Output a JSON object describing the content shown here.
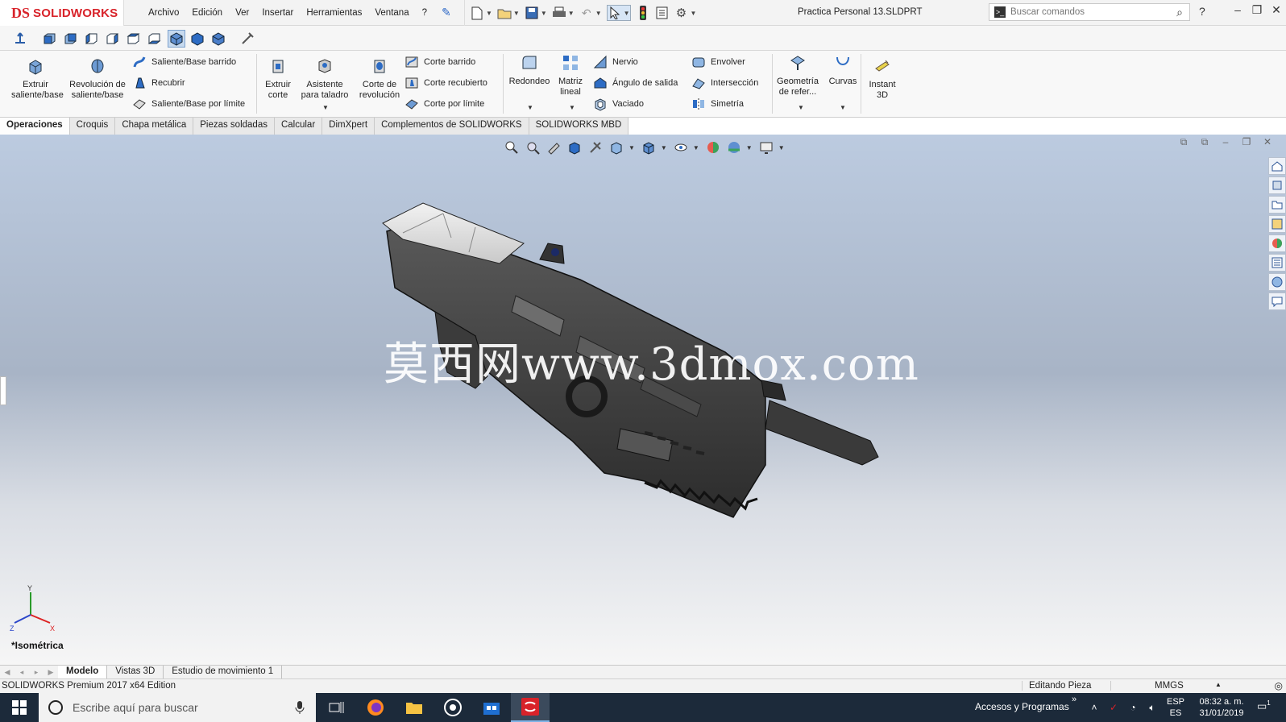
{
  "app": {
    "brand": "SOLIDWORKS",
    "logo_mark": "DS",
    "document_title": "Practica Personal 13.SLDPRT"
  },
  "menu": [
    "Archivo",
    "Edición",
    "Ver",
    "Insertar",
    "Herramientas",
    "Ventana",
    "?"
  ],
  "search": {
    "placeholder": "Buscar comandos"
  },
  "window_controls": {
    "help": "?",
    "minimize": "–",
    "restore": "❐",
    "close": "✕"
  },
  "ribbon": {
    "extruir_saliente": "Extruir saliente/base",
    "revolucion_saliente": "Revolución de saliente/base",
    "saliente_barrido": "Saliente/Base barrido",
    "recubrir": "Recubrir",
    "saliente_limite": "Saliente/Base por límite",
    "extruir_corte": "Extruir corte",
    "asistente_taladro": "Asistente para taladro",
    "corte_revolucion": "Corte de revolución",
    "corte_barrido": "Corte barrido",
    "corte_recubierto": "Corte recubierto",
    "corte_limite": "Corte por límite",
    "redondeo": "Redondeo",
    "matriz_lineal": "Matriz lineal",
    "nervio": "Nervio",
    "angulo_salida": "Ángulo de salida",
    "vaciado": "Vaciado",
    "envolver": "Envolver",
    "interseccion": "Intersección",
    "simetria": "Simetría",
    "geometria_ref": "Geometría de refer...",
    "curvas": "Curvas",
    "instant3d": "Instant 3D"
  },
  "command_tabs": [
    "Operaciones",
    "Croquis",
    "Chapa metálica",
    "Piezas soldadas",
    "Calcular",
    "DimXpert",
    "Complementos de SOLIDWORKS",
    "SOLIDWORKS MBD"
  ],
  "viewport": {
    "watermark": "莫西网www.3dmox.com",
    "view_name": "*Isométrica",
    "triad": {
      "x": "X",
      "y": "Y",
      "z": "Z"
    }
  },
  "bottom_tabs": [
    "Modelo",
    "Vistas 3D",
    "Estudio de movimiento 1"
  ],
  "status": {
    "edition": "SOLIDWORKS Premium 2017 x64 Edition",
    "mode": "Editando Pieza",
    "units": "MMGS"
  },
  "taskbar": {
    "search_placeholder": "Escribe aquí para buscar",
    "tray_label": "Accesos y Programas",
    "tray_chevron": "»",
    "lang_top": "ESP",
    "lang_bottom": "ES",
    "time": "08:32 a. m.",
    "date": "31/01/2019",
    "notifications": "1"
  },
  "colors": {
    "brand_red": "#d8232a",
    "viewport_top": "#bccbe0",
    "taskbar": "#1c2a3a"
  }
}
